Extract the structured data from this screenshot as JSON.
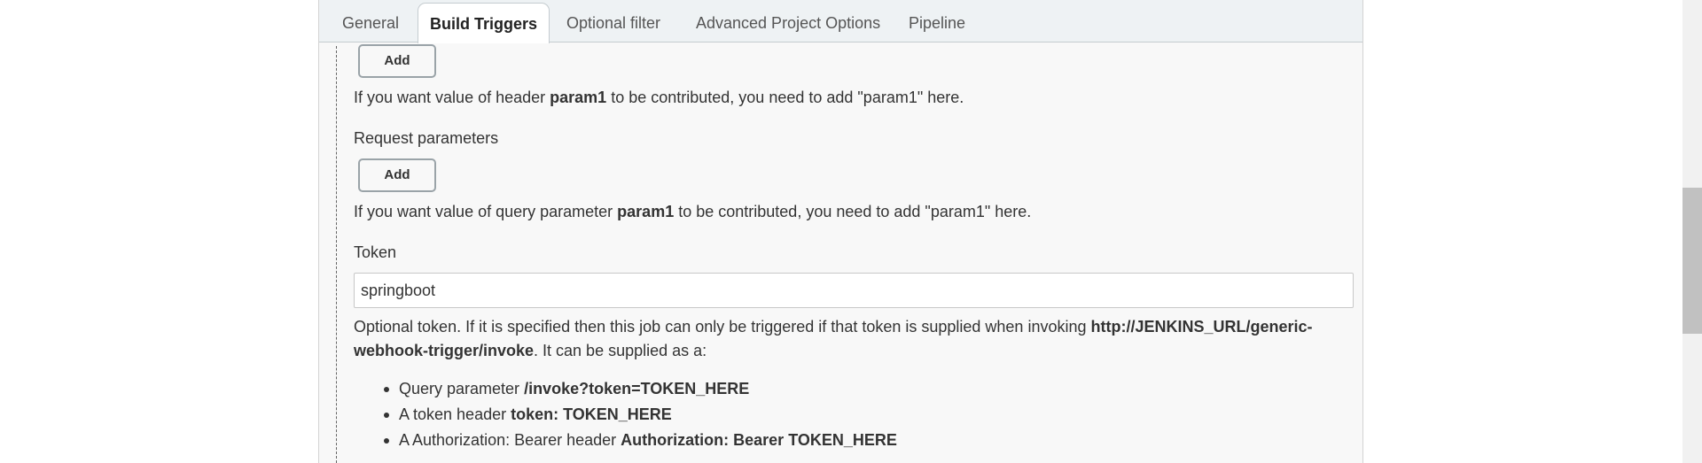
{
  "tabs": [
    {
      "label": "General",
      "active": false
    },
    {
      "label": "Build Triggers",
      "active": true
    },
    {
      "label": "Optional filter",
      "active": false
    },
    {
      "label": "Advanced Project Options",
      "active": false
    },
    {
      "label": "Pipeline",
      "active": false
    }
  ],
  "header_params": {
    "add_label": "Add",
    "help_pre": "If you want value of header ",
    "help_param": "param1",
    "help_post": " to be contributed, you need to add \"param1\" here."
  },
  "request_params": {
    "label": "Request parameters",
    "add_label": "Add",
    "help_pre": "If you want value of query parameter ",
    "help_param": "param1",
    "help_post": " to be contributed, you need to add \"param1\" here."
  },
  "token": {
    "label": "Token",
    "value": "springboot",
    "help_pre": "Optional token. If it is specified then this job can only be triggered if that token is supplied when invoking ",
    "help_url": "http://JENKINS_URL/generic-webhook-trigger/invoke",
    "help_post": ". It can be supplied as a:",
    "options": [
      {
        "text": "Query parameter ",
        "bold": "/invoke?token=TOKEN_HERE"
      },
      {
        "text": "A token header ",
        "bold": "token: TOKEN_HERE"
      },
      {
        "text": "A Authorization: Bearer header ",
        "bold": "Authorization: Bearer TOKEN_HERE"
      }
    ]
  },
  "colors": {
    "panel_bg": "#f8f8f8",
    "tabbar_bg": "#eef2f4",
    "text": "#333333"
  }
}
